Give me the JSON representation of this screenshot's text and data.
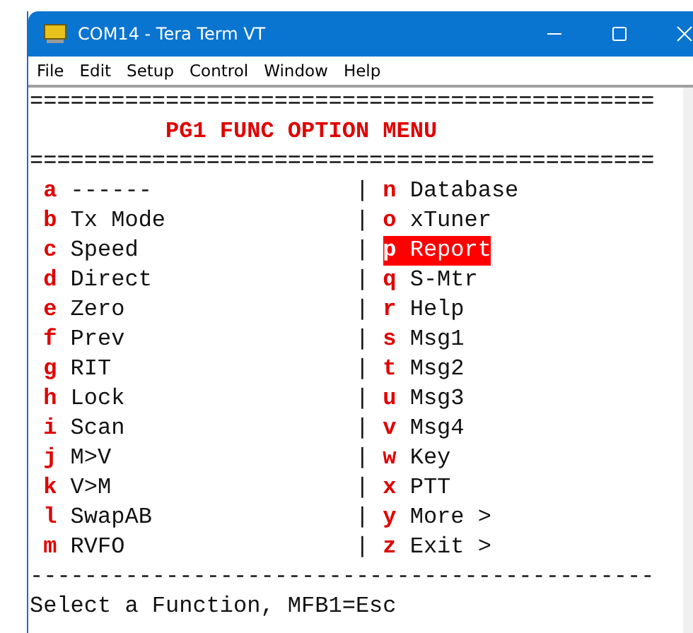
{
  "window": {
    "title": "COM14 - Tera Term VT"
  },
  "menu_bar": [
    "File",
    "Edit",
    "Setup",
    "Control",
    "Window",
    "Help"
  ],
  "terminal": {
    "top_rule": "==============================================",
    "heading": "PG1 FUNC OPTION MENU",
    "heading_rule": "==============================================",
    "rows": [
      {
        "left": {
          "key": "a",
          "label": "------",
          "selected": false
        },
        "divider": "|",
        "right": {
          "key": "n",
          "label": "Database",
          "selected": false
        }
      },
      {
        "left": {
          "key": "b",
          "label": "Tx Mode",
          "selected": false
        },
        "divider": "|",
        "right": {
          "key": "o",
          "label": "xTuner",
          "selected": false
        }
      },
      {
        "left": {
          "key": "c",
          "label": "Speed",
          "selected": false
        },
        "divider": "|",
        "right": {
          "key": "p",
          "label": "Report",
          "selected": true
        }
      },
      {
        "left": {
          "key": "d",
          "label": "Direct",
          "selected": false
        },
        "divider": "|",
        "right": {
          "key": "q",
          "label": "S-Mtr",
          "selected": false
        }
      },
      {
        "left": {
          "key": "e",
          "label": "Zero",
          "selected": false
        },
        "divider": "|",
        "right": {
          "key": "r",
          "label": "Help",
          "selected": false
        }
      },
      {
        "left": {
          "key": "f",
          "label": "Prev",
          "selected": false
        },
        "divider": "|",
        "right": {
          "key": "s",
          "label": "Msg1",
          "selected": false
        }
      },
      {
        "left": {
          "key": "g",
          "label": "RIT",
          "selected": false
        },
        "divider": "|",
        "right": {
          "key": "t",
          "label": "Msg2",
          "selected": false
        }
      },
      {
        "left": {
          "key": "h",
          "label": "Lock",
          "selected": false
        },
        "divider": "|",
        "right": {
          "key": "u",
          "label": "Msg3",
          "selected": false
        }
      },
      {
        "left": {
          "key": "i",
          "label": "Scan",
          "selected": false
        },
        "divider": "|",
        "right": {
          "key": "v",
          "label": "Msg4",
          "selected": false
        }
      },
      {
        "left": {
          "key": "j",
          "label": "M>V",
          "selected": false
        },
        "divider": "|",
        "right": {
          "key": "w",
          "label": "Key",
          "selected": false
        }
      },
      {
        "left": {
          "key": "k",
          "label": "V>M",
          "selected": false
        },
        "divider": "|",
        "right": {
          "key": "x",
          "label": "PTT",
          "selected": false
        }
      },
      {
        "left": {
          "key": "l",
          "label": "SwapAB",
          "selected": false
        },
        "divider": "|",
        "right": {
          "key": "y",
          "label": "More >",
          "selected": false
        }
      },
      {
        "left": {
          "key": "m",
          "label": "RVFO",
          "selected": false
        },
        "divider": "|",
        "right": {
          "key": "z",
          "label": "Exit >",
          "selected": false
        }
      }
    ],
    "bottom_rule": "----------------------------------------------",
    "prompt": "Select a Function, MFB1=Esc"
  }
}
